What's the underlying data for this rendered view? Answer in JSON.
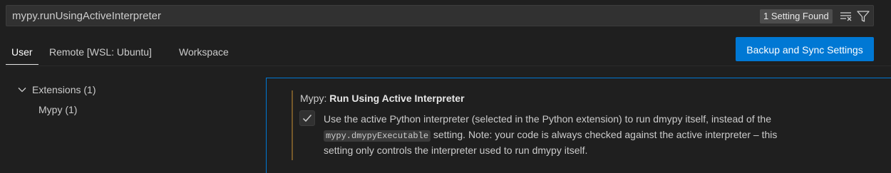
{
  "search": {
    "value": "mypy.runUsingActiveInterpreter",
    "count_label": "1 Setting Found",
    "clear_icon": "clear-filter-icon",
    "filter_icon": "filter-icon"
  },
  "tabs": [
    {
      "label": "User",
      "active": true
    },
    {
      "label": "Remote [WSL: Ubuntu]",
      "active": false
    },
    {
      "label": "Workspace",
      "active": false
    }
  ],
  "sync_button": {
    "label": "Backup and Sync Settings"
  },
  "toc": {
    "extensions": {
      "label": "Extensions (1)",
      "icon": "chevron-down-icon"
    },
    "mypy": {
      "label": "Mypy (1)"
    }
  },
  "setting": {
    "category": "Mypy: ",
    "title": "Run Using Active Interpreter",
    "checked": true,
    "desc_line1": "Use the active Python interpreter (selected in the Python extension) to run dmypy itself, instead of the",
    "desc_code": "mypy.dmypyExecutable",
    "desc_line2_rest": " setting. Note: your code is always checked against the active interpreter – this",
    "desc_line3": "setting only controls the interpreter used to run dmypy itself."
  },
  "colors": {
    "accent": "#0078d4",
    "background": "#1f1f1f",
    "modified_indicator": "#75592a"
  }
}
